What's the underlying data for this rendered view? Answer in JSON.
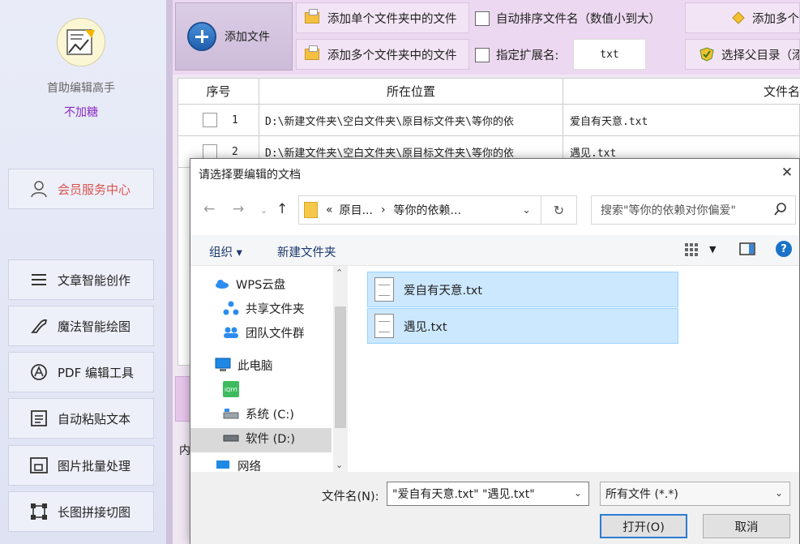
{
  "sidebar": {
    "app_name": "首助编辑高手",
    "subtitle": "不加糖",
    "member_label": "会员服务中心",
    "items": [
      {
        "label": "文章智能创作",
        "icon": "menu-lines-icon"
      },
      {
        "label": "魔法智能绘图",
        "icon": "magic-wand-icon"
      },
      {
        "label": "PDF 编辑工具",
        "icon": "pdf-icon"
      },
      {
        "label": "自动粘贴文本",
        "icon": "paste-icon"
      },
      {
        "label": "图片批量处理",
        "icon": "image-batch-icon"
      },
      {
        "label": "长图拼接切图",
        "icon": "crop-icon"
      }
    ]
  },
  "toolbar": {
    "add_file": "添加文件",
    "add_single_folder": "添加单个文件夹中的文件",
    "add_multi_folder": "添加多个文件夹中的文件",
    "auto_sort": "自动排序文件名（数值小到大）",
    "ext_label": "指定扩展名:",
    "ext_value": "txt",
    "add_multi_partial": "添加多个",
    "choose_parent": "选择父目录（添"
  },
  "table": {
    "headers": [
      "序号",
      "所在位置",
      "文件名"
    ],
    "rows": [
      {
        "index": "1",
        "path": "D:\\新建文件夹\\空白文件夹\\原目标文件夹\\等你的依",
        "name": "爱自有天意.txt"
      },
      {
        "index": "2",
        "path": "D:\\新建文件夹\\空白文件夹\\原目标文件夹\\等你的依",
        "name": "遇见.txt"
      }
    ],
    "lower_label": "内"
  },
  "dialog": {
    "title": "请选择要编辑的文档",
    "breadcrumb_prefix": "«",
    "breadcrumb_1": "原目...",
    "breadcrumb_sep": "›",
    "breadcrumb_2": "等你的依赖...",
    "search_placeholder": "搜索\"等你的依赖对你偏爱\"",
    "organize": "组织 ▾",
    "new_folder": "新建文件夹",
    "nav_items": [
      {
        "label": "WPS云盘",
        "icon": "cloud-icon"
      },
      {
        "label": "共享文件夹",
        "icon": "share-icon"
      },
      {
        "label": "团队文件群",
        "icon": "team-icon"
      },
      {
        "label": "此电脑",
        "icon": "computer-icon"
      },
      {
        "label": "",
        "icon": "app-icon"
      },
      {
        "label": "系统 (C:)",
        "icon": "drive-icon"
      },
      {
        "label": "软件 (D:)",
        "icon": "drive-icon"
      },
      {
        "label": "网络",
        "icon": "network-icon"
      }
    ],
    "files": [
      "爱自有天意.txt",
      "遇见.txt"
    ],
    "filename_label": "文件名(N):",
    "filename_value": "\"爱自有天意.txt\" \"遇见.txt\"",
    "filetype": "所有文件 (*.*)",
    "open_btn": "打开(O)",
    "cancel_btn": "取消"
  }
}
